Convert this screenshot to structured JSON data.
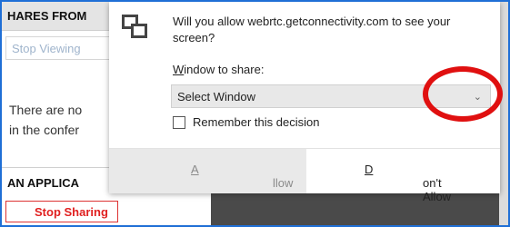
{
  "background": {
    "header": "HARES FROM",
    "stop_viewing": "Stop Viewing",
    "info_line1": "There are no",
    "info_line2": "in the confer",
    "section_title": "AN APPLICA",
    "stop_sharing": "Stop Sharing"
  },
  "dialog": {
    "icon": "screen-share-icon",
    "prompt": "Will you allow webrtc.getconnectivity.com to see your screen?",
    "window_label_mnemonic": "W",
    "window_label_rest": "indow to share:",
    "select_value": "Select Window",
    "select_chevron": "chevron-down-icon",
    "remember_label": "Remember this decision",
    "remember_checked": false,
    "allow_mnemonic": "A",
    "allow_rest": "llow",
    "deny_mnemonic": "D",
    "deny_rest": "on't Allow"
  },
  "annotation": {
    "color": "#e01010"
  }
}
